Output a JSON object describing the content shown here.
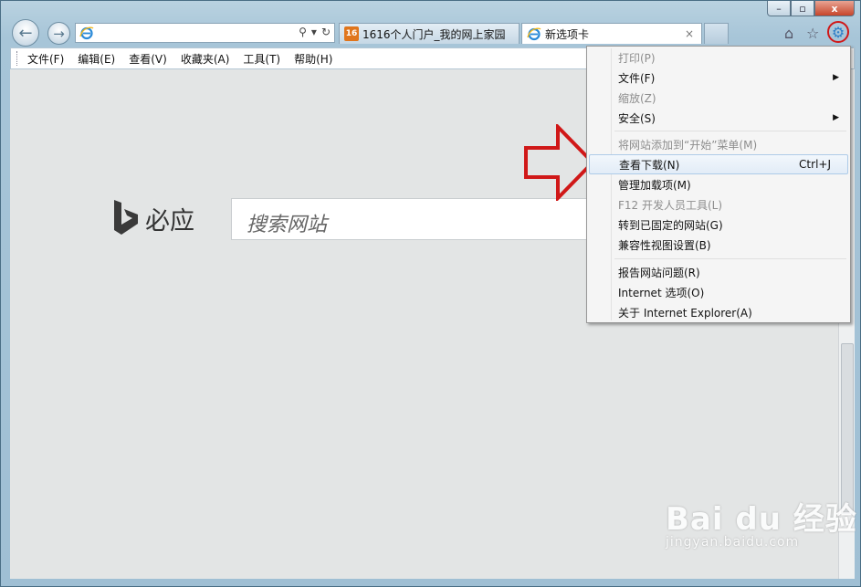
{
  "address": {
    "value": "",
    "placeholder": ""
  },
  "tabs": [
    {
      "label": "1616个人门户_我的网上家园",
      "favicon": "16"
    },
    {
      "label": "新选项卡",
      "close": "×"
    }
  ],
  "menubar": [
    "文件(F)",
    "编辑(E)",
    "查看(V)",
    "收藏夹(A)",
    "工具(T)",
    "帮助(H)"
  ],
  "bing": {
    "brand": "必应",
    "placeholder": "搜索网站"
  },
  "dropdown": {
    "items": [
      {
        "label": "打印(P)",
        "disabled": true
      },
      {
        "label": "文件(F)",
        "submenu": true
      },
      {
        "label": "缩放(Z)",
        "disabled": true
      },
      {
        "label": "安全(S)",
        "submenu": true
      },
      {
        "label": "将网站添加到“开始”菜单(M)",
        "disabled": true
      },
      {
        "label": "查看下载(N)",
        "shortcut": "Ctrl+J",
        "highlighted": true
      },
      {
        "label": "管理加载项(M)"
      },
      {
        "label": "F12 开发人员工具(L)",
        "disabled": true
      },
      {
        "label": "转到已固定的网站(G)"
      },
      {
        "label": "兼容性视图设置(B)"
      },
      {
        "label": "报告网站问题(R)"
      },
      {
        "label": "Internet 选项(O)"
      },
      {
        "label": "关于 Internet Explorer(A)"
      }
    ]
  },
  "window": {
    "minimize": "–",
    "maximize": "▫",
    "close": "x"
  },
  "watermark": {
    "brand": "Bai du 经验",
    "url": "jingyan.baidu.com"
  },
  "colors": {
    "highlight_circle": "#d01818",
    "arrow": "#d01818",
    "menu_bg": "#f5f5f5"
  }
}
